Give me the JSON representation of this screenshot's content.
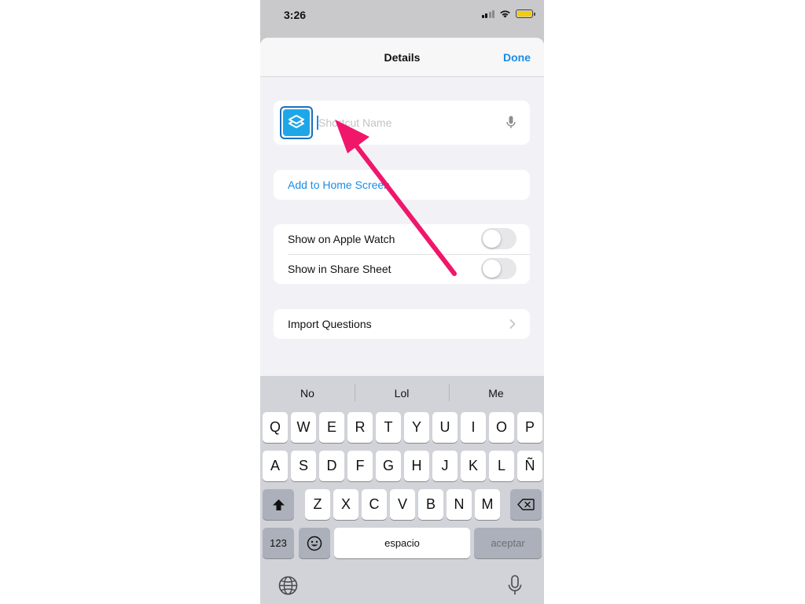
{
  "status_bar": {
    "time": "3:26",
    "battery_color": "#f2cc0d",
    "icons": [
      "signal-icon",
      "wifi-icon",
      "battery-icon"
    ]
  },
  "nav": {
    "title": "Details",
    "done_label": "Done",
    "accent_color": "#1a8ce6"
  },
  "name_field": {
    "placeholder": "Shortcut Name",
    "value": "",
    "icon": "shortcuts-icon",
    "icon_color": "#1ea7e8"
  },
  "add_to_home_label": "Add to Home Screen",
  "toggles": [
    {
      "label": "Show on Apple Watch",
      "on": false
    },
    {
      "label": "Show in Share Sheet",
      "on": false
    }
  ],
  "import_questions_label": "Import Questions",
  "keyboard": {
    "suggestions": [
      "No",
      "Lol",
      "Me"
    ],
    "row1": [
      "Q",
      "W",
      "E",
      "R",
      "T",
      "Y",
      "U",
      "I",
      "O",
      "P"
    ],
    "row2": [
      "A",
      "S",
      "D",
      "F",
      "G",
      "H",
      "J",
      "K",
      "L",
      "Ñ"
    ],
    "row3": [
      "Z",
      "X",
      "C",
      "V",
      "B",
      "N",
      "M"
    ],
    "numbers_label": "123",
    "space_label": "espacio",
    "return_label": "aceptar"
  },
  "annotation": {
    "arrow_color": "#f0176b"
  }
}
